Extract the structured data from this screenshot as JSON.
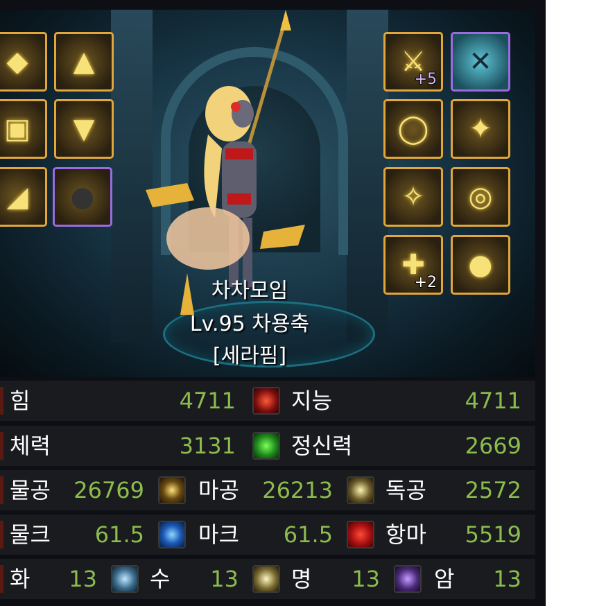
{
  "character": {
    "guild": "차차모임",
    "level_line": "Lv.95 차용축",
    "class_line": "[세라핌]"
  },
  "equipment": {
    "left_slots": [
      {
        "icon": "gold-armor-top-icon",
        "frame": "gold"
      },
      {
        "icon": "gold-helmet-icon",
        "frame": "gold"
      },
      {
        "icon": "gold-armor-chest-icon",
        "frame": "gold"
      },
      {
        "icon": "gold-pants-icon",
        "frame": "gold"
      },
      {
        "icon": "gold-boots-icon",
        "frame": "gold"
      },
      {
        "icon": "creature-portrait-icon",
        "frame": "purple"
      }
    ],
    "right_slots": [
      {
        "icon": "gold-weapon-icon",
        "frame": "gold",
        "plus": "+5"
      },
      {
        "icon": "crossed-tools-title-icon",
        "frame": "purple"
      },
      {
        "icon": "gold-ring-icon",
        "frame": "gold"
      },
      {
        "icon": "gold-necklace-icon",
        "frame": "gold"
      },
      {
        "icon": "gold-bracelet-icon",
        "frame": "gold"
      },
      {
        "icon": "gold-ring-2-icon",
        "frame": "gold"
      },
      {
        "icon": "gold-support-icon",
        "frame": "gold",
        "plus": "+2"
      },
      {
        "icon": "gold-magic-stone-icon",
        "frame": "gold"
      }
    ]
  },
  "stats": {
    "row1": {
      "a_label": "힘",
      "a_value": "4711",
      "b_label": "지능",
      "b_value": "4711"
    },
    "row2": {
      "a_label": "체력",
      "a_value": "3131",
      "b_label": "정신력",
      "b_value": "2669"
    },
    "row3": {
      "a_label": "물공",
      "a_value": "26769",
      "b_label": "마공",
      "b_value": "26213",
      "c_label": "독공",
      "c_value": "2572"
    },
    "row4": {
      "a_label": "물크",
      "a_value": "61.5",
      "b_label": "마크",
      "b_value": "61.5",
      "c_label": "항마",
      "c_value": "5519"
    },
    "row5": {
      "a_label": "화",
      "a_value": "13",
      "b_label": "수",
      "b_value": "13",
      "c_label": "명",
      "c_value": "13",
      "d_label": "암",
      "d_value": "13"
    }
  },
  "colors": {
    "value_green": "#8bbc4c",
    "slot_gold": "#e2a73a",
    "slot_purple": "#9b6be0"
  }
}
